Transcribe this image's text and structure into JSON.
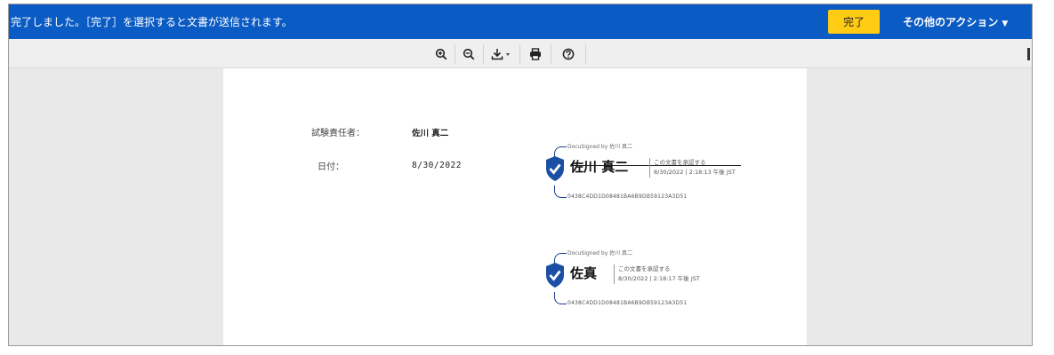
{
  "banner": {
    "message": "完了しました。［完了］を選択すると文書が送信されます。",
    "done_label": "完了",
    "more_actions_label": "その他のアクション",
    "more_actions_caret": "▼",
    "color": "#0b5bc4",
    "done_color": "#ffcb13"
  },
  "toolbar": {
    "buttons": [
      {
        "name": "zoom-in",
        "icon": "zoom-in-icon"
      },
      {
        "name": "zoom-out",
        "icon": "zoom-out-icon"
      },
      {
        "name": "download",
        "icon": "download-icon"
      },
      {
        "name": "print",
        "icon": "print-icon"
      },
      {
        "name": "help",
        "icon": "help-icon"
      }
    ]
  },
  "document": {
    "fields": [
      {
        "label": "試験責任者：",
        "value": "佐川 真二"
      },
      {
        "label": "日付：",
        "value": "8/30/2022"
      }
    ],
    "signatures": [
      {
        "docusigned_by": "DocuSigned by 佐川 真二",
        "name": "佐川 真二",
        "approval": "この文書を承認する",
        "timestamp": "8/30/2022 | 2:18:13 午後 JST",
        "hash": "0438C4DD1D08481BA6B9DB59123A3D51",
        "struck": true
      },
      {
        "docusigned_by": "DocuSigned by 佐川 真二",
        "name": "佐真",
        "approval": "この文書を承認する",
        "timestamp": "8/30/2022 | 2:18:17 午後 JST",
        "hash": "0438C4DD1D08481BA6B9DB59123A3D51",
        "struck": false
      }
    ],
    "shield_color": "#1a4fa3"
  }
}
